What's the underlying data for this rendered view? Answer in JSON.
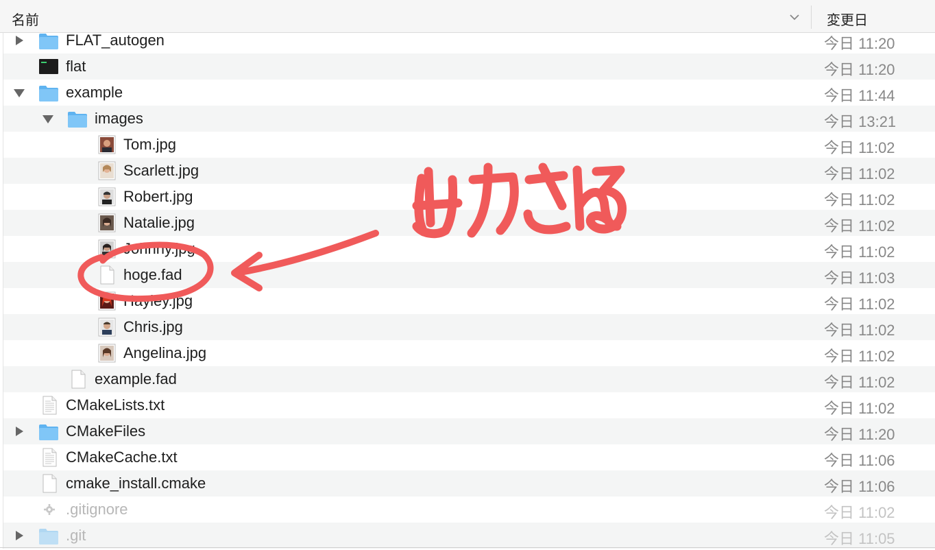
{
  "header": {
    "name_label": "名前",
    "date_label": "変更日"
  },
  "annotation": {
    "handwritten_text": "出力される"
  },
  "rows": [
    {
      "name": "FLAT_autogen",
      "date": "今日 11:20"
    },
    {
      "name": "flat",
      "date": "今日 11:20"
    },
    {
      "name": "example",
      "date": "今日 11:44"
    },
    {
      "name": "images",
      "date": "今日 13:21"
    },
    {
      "name": "Tom.jpg",
      "date": "今日 11:02"
    },
    {
      "name": "Scarlett.jpg",
      "date": "今日 11:02"
    },
    {
      "name": "Robert.jpg",
      "date": "今日 11:02"
    },
    {
      "name": "Natalie.jpg",
      "date": "今日 11:02"
    },
    {
      "name": "Johnny.jpg",
      "date": "今日 11:02"
    },
    {
      "name": "hoge.fad",
      "date": "今日 11:03"
    },
    {
      "name": "Hayley.jpg",
      "date": "今日 11:02"
    },
    {
      "name": "Chris.jpg",
      "date": "今日 11:02"
    },
    {
      "name": "Angelina.jpg",
      "date": "今日 11:02"
    },
    {
      "name": "example.fad",
      "date": "今日 11:02"
    },
    {
      "name": "CMakeLists.txt",
      "date": "今日 11:02"
    },
    {
      "name": "CMakeFiles",
      "date": "今日 11:20"
    },
    {
      "name": "CMakeCache.txt",
      "date": "今日 11:06"
    },
    {
      "name": "cmake_install.cmake",
      "date": "今日 11:06"
    },
    {
      "name": ".gitignore",
      "date": "今日 11:02"
    },
    {
      "name": ".git",
      "date": "今日 11:05"
    }
  ],
  "colors": {
    "folder": "#5fb3f0",
    "annotation": "#f05a5a",
    "alt_row": "#f4f5f5"
  }
}
